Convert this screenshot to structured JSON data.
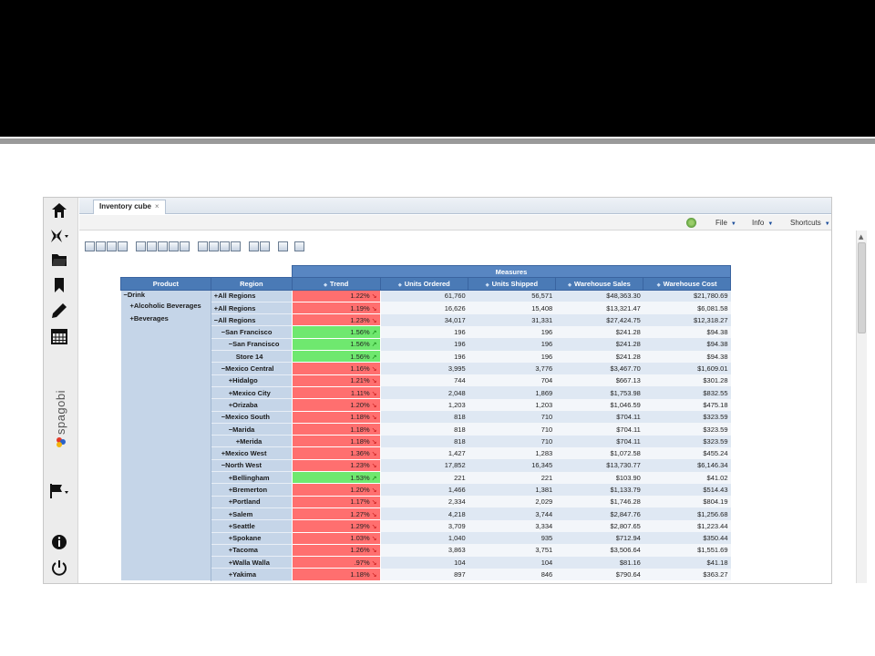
{
  "tab": {
    "label": "Inventory cube",
    "close": "×"
  },
  "menus": [
    {
      "label": "File",
      "arrow": "▼"
    },
    {
      "label": "Info",
      "arrow": "▼"
    },
    {
      "label": "Shortcuts",
      "arrow": "▼"
    }
  ],
  "sidebar": {
    "logo_text": "spagobi",
    "icons": [
      "home-icon",
      "analysis-icon",
      "folder-icon",
      "bookmark-icon",
      "pencil-icon",
      "calendar-icon",
      "flag-icon",
      "info-icon",
      "power-icon"
    ]
  },
  "pivot": {
    "measures_header": "Measures",
    "dim_headers": [
      "Product",
      "Region"
    ],
    "measure_headers": [
      "Trend",
      "Units Ordered",
      "Units Shipped",
      "Warehouse Sales",
      "Warehouse Cost"
    ],
    "rows": [
      {
        "product": "−Drink",
        "region": "+All Regions",
        "indent": 0,
        "trend": "1.22%",
        "up": false,
        "ordered": "61,760",
        "shipped": "56,571",
        "sales": "$48,363.30",
        "cost": "$21,780.69"
      },
      {
        "product": "+Alcoholic Beverages",
        "region": "+All Regions",
        "indent": 0,
        "trend": "1.19%",
        "up": false,
        "ordered": "16,626",
        "shipped": "15,408",
        "sales": "$13,321.47",
        "cost": "$6,081.58"
      },
      {
        "product": "+Beverages",
        "region": "−All Regions",
        "indent": 0,
        "trend": "1.23%",
        "up": false,
        "ordered": "34,017",
        "shipped": "31,331",
        "sales": "$27,424.75",
        "cost": "$12,318.27"
      },
      {
        "product": "",
        "region": "−San Francisco",
        "indent": 1,
        "trend": "1.56%",
        "up": true,
        "ordered": "196",
        "shipped": "196",
        "sales": "$241.28",
        "cost": "$94.38"
      },
      {
        "product": "",
        "region": "−San Francisco",
        "indent": 2,
        "trend": "1.56%",
        "up": true,
        "ordered": "196",
        "shipped": "196",
        "sales": "$241.28",
        "cost": "$94.38"
      },
      {
        "product": "",
        "region": "Store 14",
        "indent": 3,
        "trend": "1.56%",
        "up": true,
        "ordered": "196",
        "shipped": "196",
        "sales": "$241.28",
        "cost": "$94.38"
      },
      {
        "product": "",
        "region": "−Mexico Central",
        "indent": 1,
        "trend": "1.16%",
        "up": false,
        "ordered": "3,995",
        "shipped": "3,776",
        "sales": "$3,467.70",
        "cost": "$1,609.01"
      },
      {
        "product": "",
        "region": "+Hidalgo",
        "indent": 2,
        "trend": "1.21%",
        "up": false,
        "ordered": "744",
        "shipped": "704",
        "sales": "$667.13",
        "cost": "$301.28"
      },
      {
        "product": "",
        "region": "+Mexico City",
        "indent": 2,
        "trend": "1.11%",
        "up": false,
        "ordered": "2,048",
        "shipped": "1,869",
        "sales": "$1,753.98",
        "cost": "$832.55"
      },
      {
        "product": "",
        "region": "+Orizaba",
        "indent": 2,
        "trend": "1.20%",
        "up": false,
        "ordered": "1,203",
        "shipped": "1,203",
        "sales": "$1,046.59",
        "cost": "$475.18"
      },
      {
        "product": "",
        "region": "−Mexico South",
        "indent": 1,
        "trend": "1.18%",
        "up": false,
        "ordered": "818",
        "shipped": "710",
        "sales": "$704.11",
        "cost": "$323.59"
      },
      {
        "product": "",
        "region": "−Marida",
        "indent": 2,
        "trend": "1.18%",
        "up": false,
        "ordered": "818",
        "shipped": "710",
        "sales": "$704.11",
        "cost": "$323.59"
      },
      {
        "product": "",
        "region": "+Merida",
        "indent": 3,
        "trend": "1.18%",
        "up": false,
        "ordered": "818",
        "shipped": "710",
        "sales": "$704.11",
        "cost": "$323.59"
      },
      {
        "product": "",
        "region": "+Mexico West",
        "indent": 1,
        "trend": "1.36%",
        "up": false,
        "ordered": "1,427",
        "shipped": "1,283",
        "sales": "$1,072.58",
        "cost": "$455.24"
      },
      {
        "product": "",
        "region": "−North West",
        "indent": 1,
        "trend": "1.23%",
        "up": false,
        "ordered": "17,852",
        "shipped": "16,345",
        "sales": "$13,730.77",
        "cost": "$6,146.34"
      },
      {
        "product": "",
        "region": "+Bellingham",
        "indent": 2,
        "trend": "1.53%",
        "up": true,
        "ordered": "221",
        "shipped": "221",
        "sales": "$103.90",
        "cost": "$41.02"
      },
      {
        "product": "",
        "region": "+Bremerton",
        "indent": 2,
        "trend": "1.20%",
        "up": false,
        "ordered": "1,466",
        "shipped": "1,381",
        "sales": "$1,133.79",
        "cost": "$514.43"
      },
      {
        "product": "",
        "region": "+Portland",
        "indent": 2,
        "trend": "1.17%",
        "up": false,
        "ordered": "2,334",
        "shipped": "2,029",
        "sales": "$1,746.28",
        "cost": "$804.19"
      },
      {
        "product": "",
        "region": "+Salem",
        "indent": 2,
        "trend": "1.27%",
        "up": false,
        "ordered": "4,218",
        "shipped": "3,744",
        "sales": "$2,847.76",
        "cost": "$1,256.68"
      },
      {
        "product": "",
        "region": "+Seattle",
        "indent": 2,
        "trend": "1.29%",
        "up": false,
        "ordered": "3,709",
        "shipped": "3,334",
        "sales": "$2,807.65",
        "cost": "$1,223.44"
      },
      {
        "product": "",
        "region": "+Spokane",
        "indent": 2,
        "trend": "1.03%",
        "up": false,
        "ordered": "1,040",
        "shipped": "935",
        "sales": "$712.94",
        "cost": "$350.44"
      },
      {
        "product": "",
        "region": "+Tacoma",
        "indent": 2,
        "trend": "1.26%",
        "up": false,
        "ordered": "3,863",
        "shipped": "3,751",
        "sales": "$3,506.64",
        "cost": "$1,551.69"
      },
      {
        "product": "",
        "region": "+Walla Walla",
        "indent": 2,
        "trend": ".97%",
        "up": false,
        "ordered": "104",
        "shipped": "104",
        "sales": "$81.16",
        "cost": "$41.18"
      },
      {
        "product": "",
        "region": "+Yakima",
        "indent": 2,
        "trend": "1.18%",
        "up": false,
        "ordered": "897",
        "shipped": "846",
        "sales": "$790.64",
        "cost": "$363.27"
      }
    ]
  },
  "colors": {
    "header": "#4a7ab6",
    "dim_cell": "#c5d5e8",
    "trend_down": "#ff6f6f",
    "trend_up": "#6fe86f"
  }
}
